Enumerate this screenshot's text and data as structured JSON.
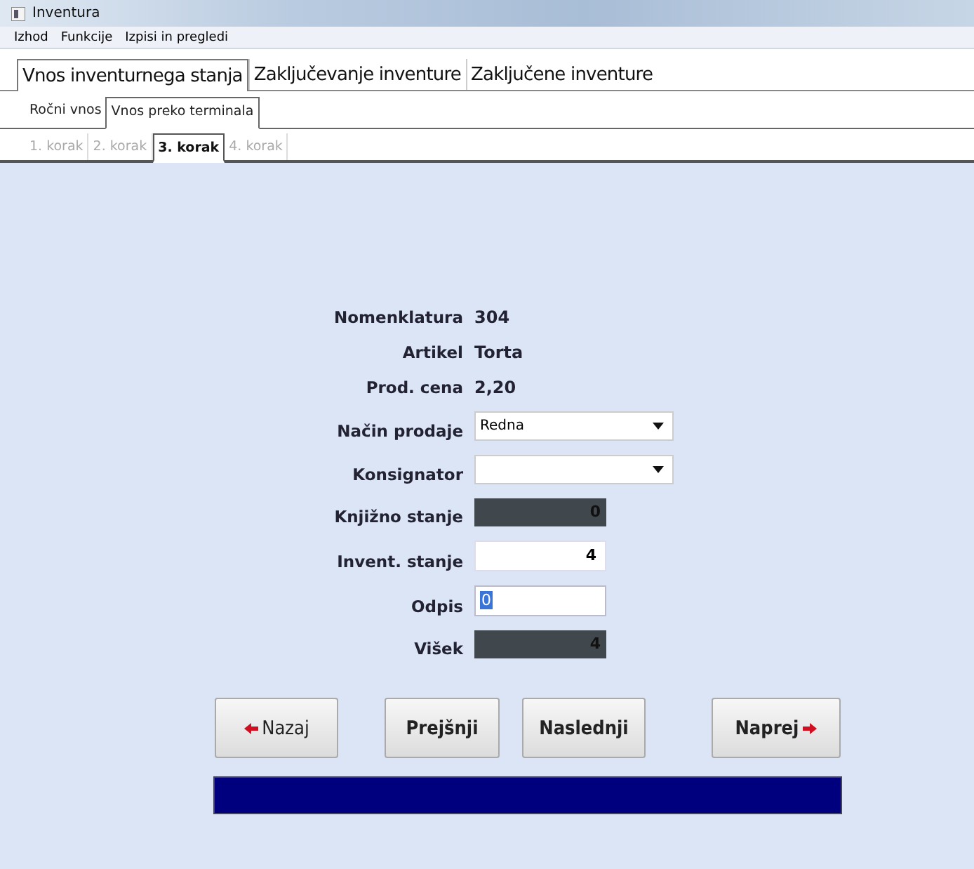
{
  "window": {
    "title": "Inventura"
  },
  "menu": [
    "Izhod",
    "Funkcije",
    "Izpisi in pregledi"
  ],
  "tabs": [
    {
      "label": "Vnos inventurnega stanja",
      "selected": true
    },
    {
      "label": "Zaključevanje inventure",
      "selected": false
    },
    {
      "label": "Zaključene inventure",
      "selected": false
    }
  ],
  "subtabs": [
    {
      "label": "Ročni vnos",
      "selected": false
    },
    {
      "label": "Vnos preko terminala",
      "selected": true
    }
  ],
  "steps": [
    {
      "label": "1. korak",
      "selected": false
    },
    {
      "label": "2. korak",
      "selected": false
    },
    {
      "label": "3. korak",
      "selected": true
    },
    {
      "label": "4. korak",
      "selected": false
    }
  ],
  "fields": [
    {
      "kind": "text",
      "label": "Nomenklatura",
      "value": "304"
    },
    {
      "kind": "text",
      "label": "Artikel",
      "value": "Torta"
    },
    {
      "kind": "text",
      "label": "Prod. cena",
      "value": "2,20"
    },
    {
      "kind": "dropdown",
      "label": "Način prodaje",
      "value": "Redna"
    },
    {
      "kind": "dropdown",
      "label": "Konsignator"
    },
    {
      "kind": "readonly",
      "label": "Knjižno stanje",
      "value": "0"
    },
    {
      "kind": "input",
      "label": "Invent. stanje",
      "value": "4",
      "focused": false
    },
    {
      "kind": "input",
      "label": "Odpis",
      "value": "0",
      "focused": true
    },
    {
      "kind": "readonly",
      "label": "Višek",
      "value": "4"
    }
  ],
  "buttons": [
    {
      "label": "Nazaj",
      "kind": "back"
    },
    {
      "label": "Prejšnji",
      "kind": "plain"
    },
    {
      "label": "Naslednji",
      "kind": "plain"
    },
    {
      "label": "Naprej",
      "kind": "forward"
    }
  ],
  "progress": {
    "level": 1
  }
}
